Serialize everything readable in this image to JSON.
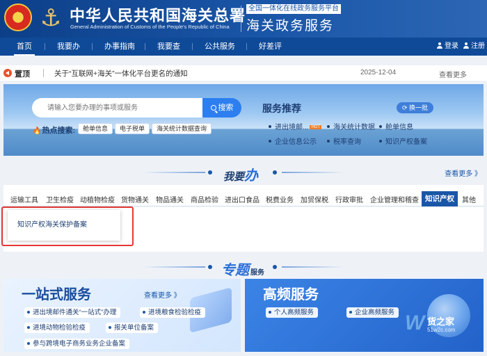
{
  "header": {
    "title_cn": "中华人民共和国海关总署",
    "title_en": "General Administration of Customs of the People's Republic of China",
    "platform_tag": "全国一体化在线政务服务平台",
    "platform_title": "海关政务服务"
  },
  "nav": {
    "items": [
      "首页",
      "我要办",
      "办事指南",
      "我要查",
      "公共服务",
      "好差评"
    ],
    "login": "登录",
    "register": "注册"
  },
  "notice": {
    "label": "置顶",
    "text": "关于“互联网+海关”一体化平台更名的通知",
    "date": "2025-12-04",
    "more": "查看更多"
  },
  "search": {
    "placeholder": "请输入您要办理的事项或服务",
    "button": "搜索",
    "hot_label": "热点搜索:",
    "hot_tags": [
      "舱单信息",
      "电子税单",
      "海关统计数据查询"
    ]
  },
  "recommend": {
    "title": "服务推荐",
    "swap": "换一批",
    "items": [
      "进出境邮...",
      "海关统计数据...",
      "舱单信息",
      "企业信息公示",
      "税率查询",
      "知识产权备案"
    ],
    "hot_badge": "HOT"
  },
  "section_do": {
    "title_prefix": "我要",
    "title_big": "办",
    "more": "查看更多 》"
  },
  "categories": {
    "tabs": [
      "运输工具",
      "卫生检疫",
      "动植物检疫",
      "货物通关",
      "物品通关",
      "商品检验",
      "进出口食品",
      "税费业务",
      "加贸保税",
      "行政审批",
      "企业管理和稽查",
      "知识产权",
      "其他"
    ],
    "active": "知识产权",
    "result": "知识产权海关保护备案"
  },
  "section_topic": {
    "title": "专题",
    "suffix": "服务"
  },
  "card_onestop": {
    "title": "一站式服务",
    "more": "查看更多 》",
    "items": [
      "进出境邮件通关“一站式”办理",
      "进境粮食检验检疫",
      "进境动物检验检疫",
      "报关单位备案",
      "参与跨境电子商务业务企业备案"
    ]
  },
  "card_highfreq": {
    "title": "高频服务",
    "items": [
      "个人高频服务",
      "企业高频服务"
    ]
  },
  "watermark": {
    "mark": "W",
    "name": "货之家",
    "site": "51w2c.com"
  }
}
